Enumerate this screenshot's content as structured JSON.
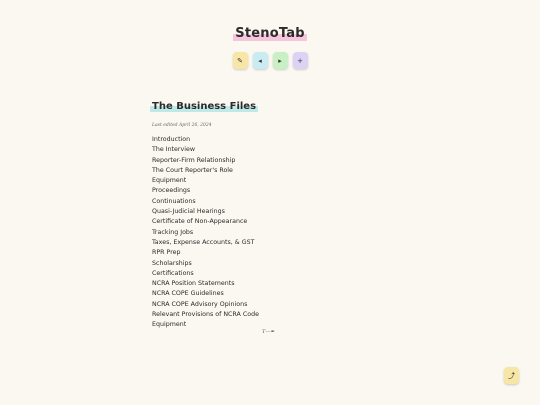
{
  "app": {
    "title": "StenoTab"
  },
  "toolbar": {
    "buttons": [
      {
        "icon": "pencil-icon",
        "glyph": "✎",
        "color": "#f8e6a6"
      },
      {
        "icon": "prev-icon",
        "glyph": "◂",
        "color": "#c9ecf2"
      },
      {
        "icon": "next-icon",
        "glyph": "▸",
        "color": "#c9efc4"
      },
      {
        "icon": "add-icon",
        "glyph": "+",
        "color": "#ddd1f5"
      }
    ]
  },
  "document": {
    "title": "The Business Files",
    "last_edited": "Last edited April 26, 2024",
    "toc": [
      "Introduction",
      "The Interview",
      "Reporter-Firm Relationship",
      "The Court Reporter's Role",
      "Equipment",
      "Proceedings",
      "Continuations",
      "Quasi-Judicial Hearings",
      "Certificate of Non-Appearance",
      "Tracking Jobs",
      "Taxes, Expense Accounts, & GST",
      "RPR Prep",
      "Scholarships",
      "Certifications",
      "NCRA Position Statements",
      "NCRA COPE Guidelines",
      "NCRA COPE Advisory Opinions",
      "Relevant Provisions of NCRA Code",
      "Equipment"
    ],
    "signoff": "T—✒"
  },
  "fab": {
    "icon": "scroll-top-icon",
    "glyph": "⤴"
  }
}
